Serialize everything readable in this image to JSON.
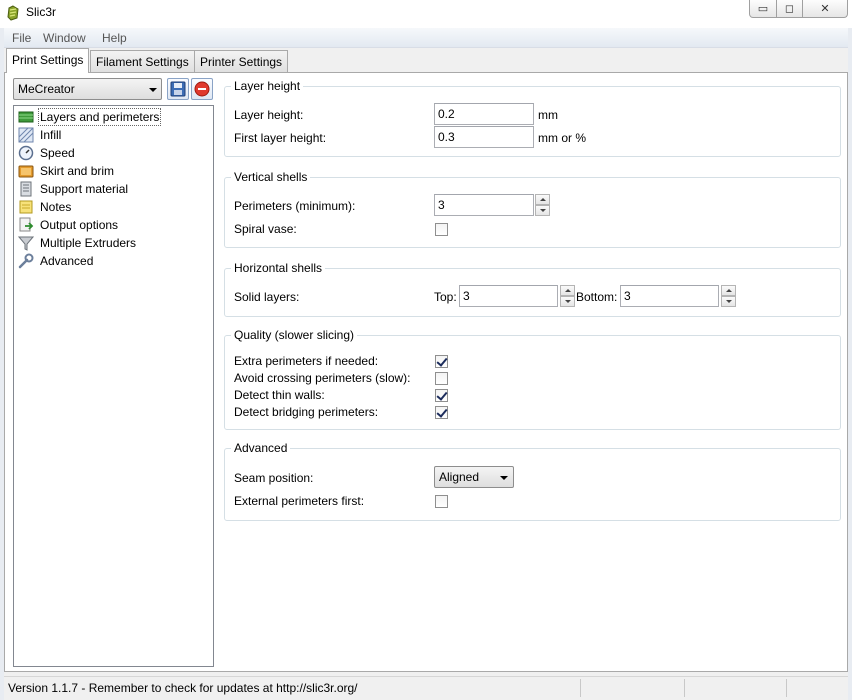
{
  "window": {
    "title": "Slic3r",
    "minimize_glyph": "▭",
    "maximize_glyph": "◻",
    "close_glyph": "✕"
  },
  "menu": [
    "File",
    "Window",
    "Help"
  ],
  "tabs": [
    {
      "label": "Print Settings",
      "active": true
    },
    {
      "label": "Filament Settings",
      "active": false
    },
    {
      "label": "Printer Settings",
      "active": false
    }
  ],
  "preset": {
    "selected": "MeCreator",
    "save_icon": "save-disk-icon",
    "delete_icon": "delete-red-circle-icon"
  },
  "tree": [
    {
      "label": "Layers and perimeters",
      "icon": "layers-icon",
      "selected": true
    },
    {
      "label": "Infill",
      "icon": "infill-icon",
      "selected": false
    },
    {
      "label": "Speed",
      "icon": "speed-gauge-icon",
      "selected": false
    },
    {
      "label": "Skirt and brim",
      "icon": "skirt-brim-icon",
      "selected": false
    },
    {
      "label": "Support material",
      "icon": "support-material-icon",
      "selected": false
    },
    {
      "label": "Notes",
      "icon": "notes-icon",
      "selected": false
    },
    {
      "label": "Output options",
      "icon": "output-options-icon",
      "selected": false
    },
    {
      "label": "Multiple Extruders",
      "icon": "funnel-icon",
      "selected": false
    },
    {
      "label": "Advanced",
      "icon": "wrench-icon",
      "selected": false
    }
  ],
  "layer_height": {
    "title": "Layer height",
    "layer_height_label": "Layer height:",
    "layer_height_value": "0.2",
    "layer_height_unit": "mm",
    "first_layer_label": "First layer height:",
    "first_layer_value": "0.3",
    "first_layer_unit": "mm or %"
  },
  "vertical_shells": {
    "title": "Vertical shells",
    "perimeters_label": "Perimeters (minimum):",
    "perimeters_value": "3",
    "spiral_label": "Spiral vase:",
    "spiral_checked": false
  },
  "horizontal_shells": {
    "title": "Horizontal shells",
    "solid_label": "Solid layers:",
    "top_label": "Top:",
    "top_value": "3",
    "bottom_label": "Bottom:",
    "bottom_value": "3"
  },
  "quality": {
    "title": "Quality (slower slicing)",
    "extra_label": "Extra perimeters if needed:",
    "extra_checked": true,
    "avoid_label": "Avoid crossing perimeters (slow):",
    "avoid_checked": false,
    "thin_label": "Detect thin walls:",
    "thin_checked": true,
    "bridging_label": "Detect bridging perimeters:",
    "bridging_checked": true
  },
  "advanced": {
    "title": "Advanced",
    "seam_label": "Seam position:",
    "seam_value": "Aligned",
    "external_label": "External perimeters first:",
    "external_checked": false
  },
  "status": {
    "text": "Version 1.1.7 - Remember to check for updates at http://slic3r.org/"
  }
}
